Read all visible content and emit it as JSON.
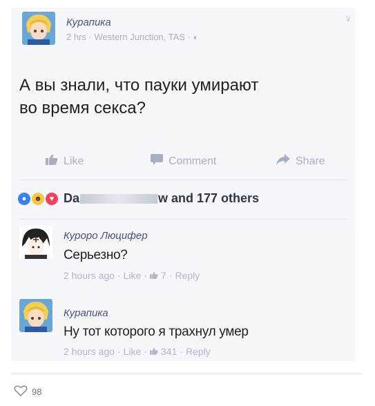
{
  "post": {
    "author": "Курапика",
    "meta": "2 hrs · Western Junction, TAS ·",
    "text_line1": "А вы знали, что пауки умирают",
    "text_line2": "во время секса?",
    "actions": {
      "like": "Like",
      "comment": "Comment",
      "share": "Share"
    },
    "reactions": {
      "name_start": "Da",
      "name_end": "w and 177 others"
    }
  },
  "comments": [
    {
      "author": "Куроро Люцифер",
      "text": "Серьезно?",
      "time": "2 hours ago",
      "like": "Like",
      "likes": "7",
      "reply": "Reply"
    },
    {
      "author": "Курапика",
      "text": "Ну тот которого я трахнул умер",
      "time": "2 hours ago",
      "like": "Like",
      "likes": "341",
      "reply": "Reply"
    }
  ],
  "footer": {
    "likes_count": "98"
  },
  "colors": {
    "background": "#f5f7fb",
    "name": "#4a5275",
    "muted": "#a9aebb"
  }
}
